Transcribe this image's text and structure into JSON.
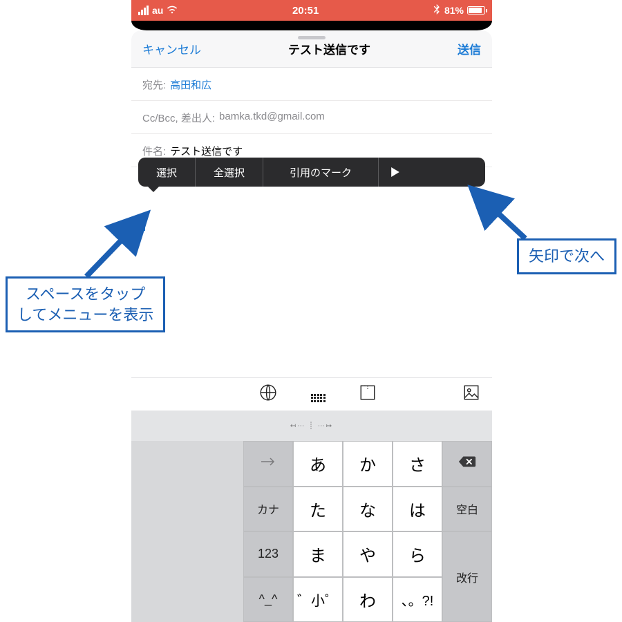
{
  "status": {
    "carrier": "au",
    "time": "20:51",
    "battery": "81%"
  },
  "nav": {
    "cancel": "キャンセル",
    "title": "テスト送信です",
    "send": "送信"
  },
  "fields": {
    "to_label": "宛先:",
    "to_value": "高田和広",
    "cc_label": "Cc/Bcc, 差出人:",
    "cc_value": "bamka.tkd@gmail.com",
    "subject_label": "件名:",
    "subject_value": "テスト送信です"
  },
  "context_menu": {
    "select": "選択",
    "select_all": "全選択",
    "quote": "引用のマーク"
  },
  "keyboard": {
    "suggestion_handle": "↤⋯ ┊ ⋯↦",
    "side": {
      "arrow": "→",
      "kana": "カナ",
      "num": "123",
      "face": "^_^"
    },
    "kana": [
      [
        "あ",
        "か",
        "さ"
      ],
      [
        "た",
        "な",
        "は"
      ],
      [
        "ま",
        "や",
        "ら"
      ],
      [
        "゛小゜",
        "わ",
        "、。?!"
      ]
    ],
    "right": {
      "space": "空白",
      "return": "改行"
    }
  },
  "annotations": {
    "right": "矢印で次へ",
    "left_l1": "スペースをタップ",
    "left_l2": "してメニューを表示"
  }
}
